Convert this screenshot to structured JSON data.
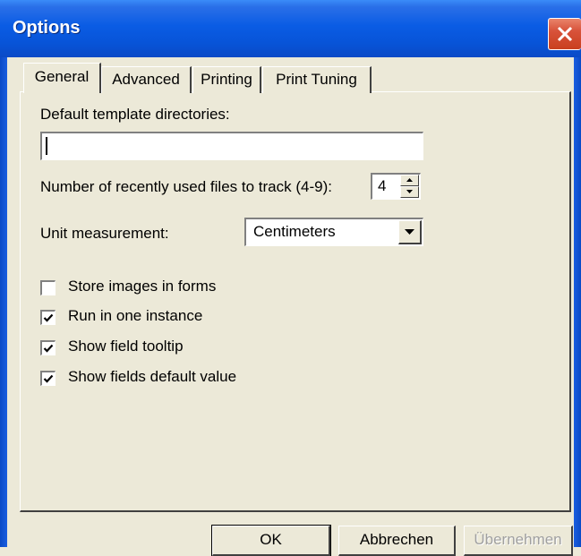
{
  "window": {
    "title": "Options"
  },
  "tabs": [
    {
      "label": "General",
      "selected": true
    },
    {
      "label": "Advanced",
      "selected": false
    },
    {
      "label": "Printing",
      "selected": false
    },
    {
      "label": "Print Tuning",
      "selected": false
    }
  ],
  "general": {
    "template_dir_label": "Default template directories:",
    "template_dir_value": "",
    "recent_files_label": "Number of recently used files to track (4-9):",
    "recent_files_value": "4",
    "unit_label": "Unit measurement:",
    "unit_value": "Centimeters",
    "checkboxes": [
      {
        "label": "Store images in forms",
        "checked": false
      },
      {
        "label": "Run in one instance",
        "checked": true
      },
      {
        "label": "Show field tooltip",
        "checked": true
      },
      {
        "label": "Show fields default value",
        "checked": true
      }
    ]
  },
  "buttons": {
    "ok": "OK",
    "cancel": "Abbrechen",
    "apply": "Übernehmen"
  },
  "colors": {
    "titlebar": "#0a5ce4",
    "dialog_bg": "#ece9d8",
    "close_button": "#d8523a"
  },
  "icons": {
    "close": "close-icon",
    "spin_up": "spin-up-arrow-icon",
    "spin_down": "spin-down-arrow-icon",
    "dropdown": "chevron-down-icon",
    "check": "checkmark-icon"
  }
}
